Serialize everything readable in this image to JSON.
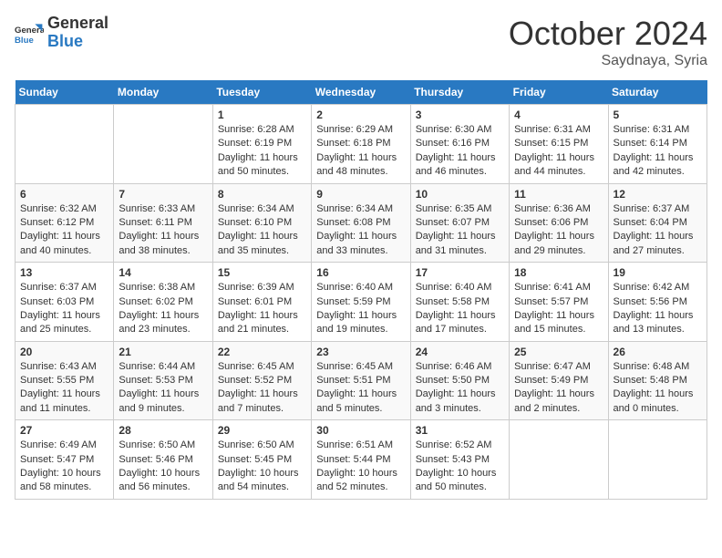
{
  "header": {
    "logo_general": "General",
    "logo_blue": "Blue",
    "month": "October 2024",
    "location": "Saydnaya, Syria"
  },
  "weekdays": [
    "Sunday",
    "Monday",
    "Tuesday",
    "Wednesday",
    "Thursday",
    "Friday",
    "Saturday"
  ],
  "weeks": [
    [
      {
        "day": "",
        "sunrise": "",
        "sunset": "",
        "daylight": ""
      },
      {
        "day": "",
        "sunrise": "",
        "sunset": "",
        "daylight": ""
      },
      {
        "day": "1",
        "sunrise": "Sunrise: 6:28 AM",
        "sunset": "Sunset: 6:19 PM",
        "daylight": "Daylight: 11 hours and 50 minutes."
      },
      {
        "day": "2",
        "sunrise": "Sunrise: 6:29 AM",
        "sunset": "Sunset: 6:18 PM",
        "daylight": "Daylight: 11 hours and 48 minutes."
      },
      {
        "day": "3",
        "sunrise": "Sunrise: 6:30 AM",
        "sunset": "Sunset: 6:16 PM",
        "daylight": "Daylight: 11 hours and 46 minutes."
      },
      {
        "day": "4",
        "sunrise": "Sunrise: 6:31 AM",
        "sunset": "Sunset: 6:15 PM",
        "daylight": "Daylight: 11 hours and 44 minutes."
      },
      {
        "day": "5",
        "sunrise": "Sunrise: 6:31 AM",
        "sunset": "Sunset: 6:14 PM",
        "daylight": "Daylight: 11 hours and 42 minutes."
      }
    ],
    [
      {
        "day": "6",
        "sunrise": "Sunrise: 6:32 AM",
        "sunset": "Sunset: 6:12 PM",
        "daylight": "Daylight: 11 hours and 40 minutes."
      },
      {
        "day": "7",
        "sunrise": "Sunrise: 6:33 AM",
        "sunset": "Sunset: 6:11 PM",
        "daylight": "Daylight: 11 hours and 38 minutes."
      },
      {
        "day": "8",
        "sunrise": "Sunrise: 6:34 AM",
        "sunset": "Sunset: 6:10 PM",
        "daylight": "Daylight: 11 hours and 35 minutes."
      },
      {
        "day": "9",
        "sunrise": "Sunrise: 6:34 AM",
        "sunset": "Sunset: 6:08 PM",
        "daylight": "Daylight: 11 hours and 33 minutes."
      },
      {
        "day": "10",
        "sunrise": "Sunrise: 6:35 AM",
        "sunset": "Sunset: 6:07 PM",
        "daylight": "Daylight: 11 hours and 31 minutes."
      },
      {
        "day": "11",
        "sunrise": "Sunrise: 6:36 AM",
        "sunset": "Sunset: 6:06 PM",
        "daylight": "Daylight: 11 hours and 29 minutes."
      },
      {
        "day": "12",
        "sunrise": "Sunrise: 6:37 AM",
        "sunset": "Sunset: 6:04 PM",
        "daylight": "Daylight: 11 hours and 27 minutes."
      }
    ],
    [
      {
        "day": "13",
        "sunrise": "Sunrise: 6:37 AM",
        "sunset": "Sunset: 6:03 PM",
        "daylight": "Daylight: 11 hours and 25 minutes."
      },
      {
        "day": "14",
        "sunrise": "Sunrise: 6:38 AM",
        "sunset": "Sunset: 6:02 PM",
        "daylight": "Daylight: 11 hours and 23 minutes."
      },
      {
        "day": "15",
        "sunrise": "Sunrise: 6:39 AM",
        "sunset": "Sunset: 6:01 PM",
        "daylight": "Daylight: 11 hours and 21 minutes."
      },
      {
        "day": "16",
        "sunrise": "Sunrise: 6:40 AM",
        "sunset": "Sunset: 5:59 PM",
        "daylight": "Daylight: 11 hours and 19 minutes."
      },
      {
        "day": "17",
        "sunrise": "Sunrise: 6:40 AM",
        "sunset": "Sunset: 5:58 PM",
        "daylight": "Daylight: 11 hours and 17 minutes."
      },
      {
        "day": "18",
        "sunrise": "Sunrise: 6:41 AM",
        "sunset": "Sunset: 5:57 PM",
        "daylight": "Daylight: 11 hours and 15 minutes."
      },
      {
        "day": "19",
        "sunrise": "Sunrise: 6:42 AM",
        "sunset": "Sunset: 5:56 PM",
        "daylight": "Daylight: 11 hours and 13 minutes."
      }
    ],
    [
      {
        "day": "20",
        "sunrise": "Sunrise: 6:43 AM",
        "sunset": "Sunset: 5:55 PM",
        "daylight": "Daylight: 11 hours and 11 minutes."
      },
      {
        "day": "21",
        "sunrise": "Sunrise: 6:44 AM",
        "sunset": "Sunset: 5:53 PM",
        "daylight": "Daylight: 11 hours and 9 minutes."
      },
      {
        "day": "22",
        "sunrise": "Sunrise: 6:45 AM",
        "sunset": "Sunset: 5:52 PM",
        "daylight": "Daylight: 11 hours and 7 minutes."
      },
      {
        "day": "23",
        "sunrise": "Sunrise: 6:45 AM",
        "sunset": "Sunset: 5:51 PM",
        "daylight": "Daylight: 11 hours and 5 minutes."
      },
      {
        "day": "24",
        "sunrise": "Sunrise: 6:46 AM",
        "sunset": "Sunset: 5:50 PM",
        "daylight": "Daylight: 11 hours and 3 minutes."
      },
      {
        "day": "25",
        "sunrise": "Sunrise: 6:47 AM",
        "sunset": "Sunset: 5:49 PM",
        "daylight": "Daylight: 11 hours and 2 minutes."
      },
      {
        "day": "26",
        "sunrise": "Sunrise: 6:48 AM",
        "sunset": "Sunset: 5:48 PM",
        "daylight": "Daylight: 11 hours and 0 minutes."
      }
    ],
    [
      {
        "day": "27",
        "sunrise": "Sunrise: 6:49 AM",
        "sunset": "Sunset: 5:47 PM",
        "daylight": "Daylight: 10 hours and 58 minutes."
      },
      {
        "day": "28",
        "sunrise": "Sunrise: 6:50 AM",
        "sunset": "Sunset: 5:46 PM",
        "daylight": "Daylight: 10 hours and 56 minutes."
      },
      {
        "day": "29",
        "sunrise": "Sunrise: 6:50 AM",
        "sunset": "Sunset: 5:45 PM",
        "daylight": "Daylight: 10 hours and 54 minutes."
      },
      {
        "day": "30",
        "sunrise": "Sunrise: 6:51 AM",
        "sunset": "Sunset: 5:44 PM",
        "daylight": "Daylight: 10 hours and 52 minutes."
      },
      {
        "day": "31",
        "sunrise": "Sunrise: 6:52 AM",
        "sunset": "Sunset: 5:43 PM",
        "daylight": "Daylight: 10 hours and 50 minutes."
      },
      {
        "day": "",
        "sunrise": "",
        "sunset": "",
        "daylight": ""
      },
      {
        "day": "",
        "sunrise": "",
        "sunset": "",
        "daylight": ""
      }
    ]
  ]
}
